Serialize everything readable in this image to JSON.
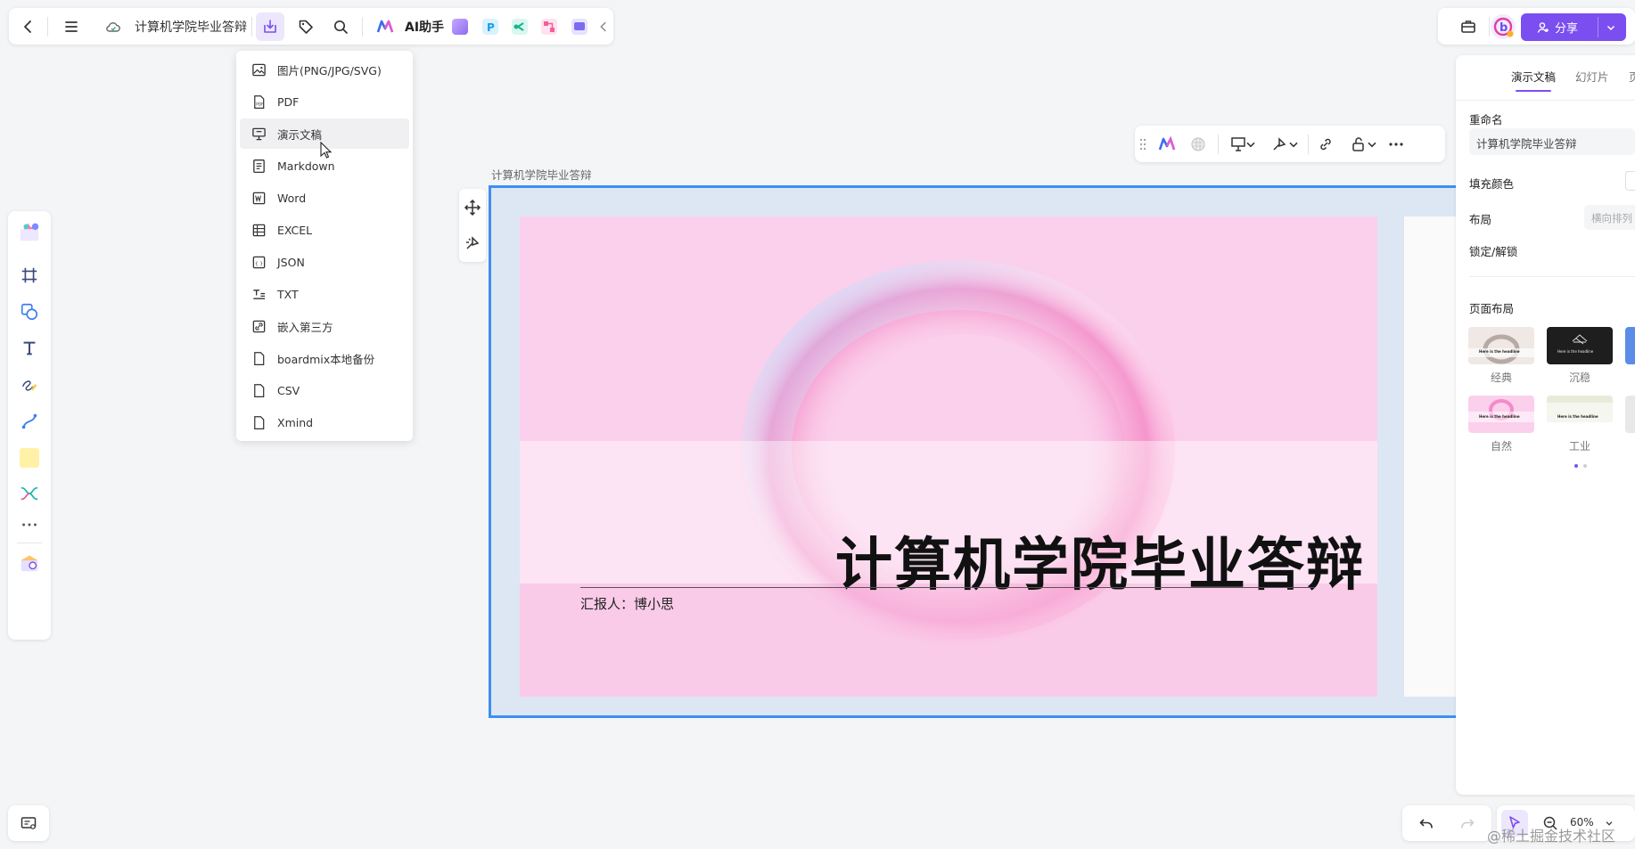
{
  "topbar": {
    "document_title": "计算机学院毕业答辩",
    "ai_label": "AI助手"
  },
  "export_menu": {
    "items": [
      {
        "label": "图片(PNG/JPG/SVG)",
        "icon": "image-icon"
      },
      {
        "label": "PDF",
        "icon": "pdf-file-icon"
      },
      {
        "label": "演示文稿",
        "icon": "presentation-icon"
      },
      {
        "label": "Markdown",
        "icon": "markdown-icon"
      },
      {
        "label": "Word",
        "icon": "word-icon"
      },
      {
        "label": "EXCEL",
        "icon": "table-icon"
      },
      {
        "label": "JSON",
        "icon": "json-icon"
      },
      {
        "label": "TXT",
        "icon": "txt-icon"
      },
      {
        "label": "嵌入第三方",
        "icon": "embed-link-icon"
      },
      {
        "label": "boardmix本地备份",
        "icon": "backup-file-icon"
      },
      {
        "label": "CSV",
        "icon": "csv-file-icon"
      },
      {
        "label": "Xmind",
        "icon": "xmind-file-icon"
      }
    ],
    "hovered_index": 2
  },
  "share": {
    "label": "分享"
  },
  "frame": {
    "label": "计算机学院毕业答辩"
  },
  "slide": {
    "title": "计算机学院毕业答辩",
    "reporter": "汇报人：博小思"
  },
  "right_panel": {
    "tabs": [
      "演示文稿",
      "幻灯片",
      "页"
    ],
    "active_tab": 0,
    "rename_label": "重命名",
    "rename_value": "计算机学院毕业答辩",
    "fill_color_label": "填充颜色",
    "layout_label": "布局",
    "layout_placeholder": "横向排列",
    "lock_label": "锁定/解锁",
    "page_layout_label": "页面布局",
    "layouts": [
      {
        "name": "经典",
        "thumb_text": "Here is the headline"
      },
      {
        "name": "沉稳",
        "thumb_text": "Here is the headline"
      },
      {
        "name": "自然",
        "thumb_text": "Here is the headline"
      },
      {
        "name": "工业",
        "thumb_text": "Here is the headline"
      }
    ]
  },
  "zoom": {
    "level": "60%"
  },
  "watermark": "@稀土掘金技术社区",
  "colors": {
    "accent": "#7b4ef0",
    "frame_border": "#3d8ff0",
    "slide_bg": "#fbd0ec"
  }
}
